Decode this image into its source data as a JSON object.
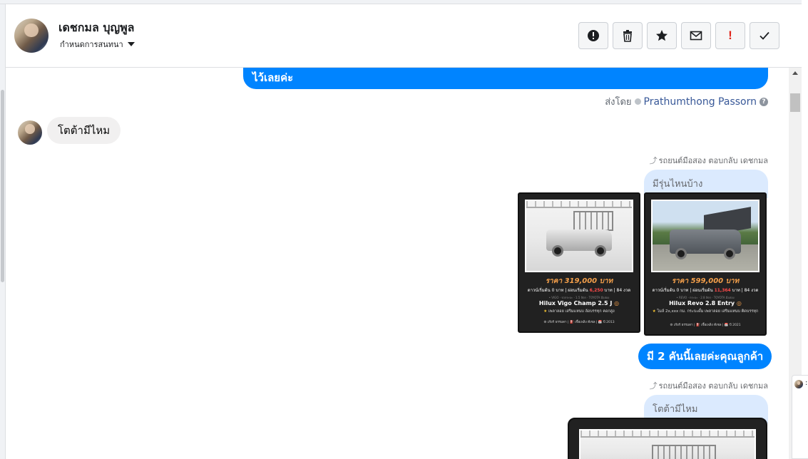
{
  "header": {
    "name": "เดชกมล บุญพูล",
    "subtitle": "กำหนดการสนทนา",
    "actions": [
      "info-icon",
      "trash-icon",
      "star-icon",
      "mail-icon",
      "alert-icon",
      "check-icon"
    ],
    "alert_symbol": "!"
  },
  "messages": {
    "top_bubble_text": "ไว้เลยค่ะ",
    "sent_by_prefix": "ส่งโดย",
    "sent_by_name": "Prathumthong Passorn",
    "help_glyph": "?",
    "incoming_text": "โตต้ามีไหม",
    "reply_note_1": "รถยนต์มือสอง ตอบกลับ เดชกมล",
    "quoted_1": "มีรุ่นไหนบ้าง",
    "card_1": {
      "price": "ราคา 319,000 บาท",
      "down_pre": "ดาวน์เริ่มต้น ",
      "down_val": "0",
      "down_mid": " บาท | ผ่อนเริ่มต้น ",
      "monthly": "6,250",
      "down_post": " บาท | 84 งวด",
      "tags": "• VIGO · รถกระบะ · 1.5 ลิตร · TOYOTA มือสอง",
      "model": "Hilux Vigo Champ 2.5 J",
      "features": "เพลาลอย เสริมแหนบ ล้อบรรทุก คอกสูง",
      "footer": "⚙ เกียร์ ธรรมดา | ⛽ เชื้อเพลิง ดีเซล | 📅 ปี 2013"
    },
    "card_2": {
      "price": "ราคา 599,000 บาท",
      "down_pre": "ดาวน์เริ่มต้น ",
      "down_val": "0",
      "down_mid": " บาท | ผ่อนเริ่มต้น ",
      "monthly": "11,364",
      "down_post": " บาท | 84 งวด",
      "tags": "• REVO · กระบะ · 2.8 ลิตร · TOYOTA มือสอง",
      "model": "Hilux Revo 2.8 Entry",
      "features": "ไมล์ 2x,xxx กม. กระบะดั้ม เพลาลอย เสริมแหนบ ติดบรรทุก",
      "footer": "⚙ เกียร์ ธรรมดา | ⛽ เชื้อเพลิง ดีเซล | 📅 ปี 2021"
    },
    "out_bubble_text": "มี 2 คันนี้เลยค่ะคุณลูกค้า",
    "reply_note_2": "รถยนต์มือสอง ตอบกลับ เดชกมล",
    "quoted_2": "โตต้ามีไหม",
    "reply_arrow": "⤴",
    "star_glyph": "★",
    "verified_glyph": "◎"
  },
  "side_peek": {
    "text": ":"
  },
  "colors": {
    "accent": "#0084ff",
    "quoted_bg": "#dbeafe",
    "incoming_bg": "#f1f0f0"
  }
}
